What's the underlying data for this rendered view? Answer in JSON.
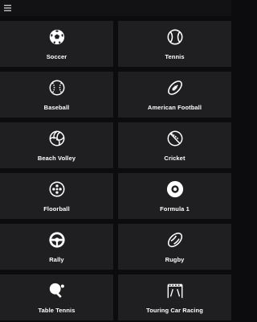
{
  "header": {
    "menu_icon": "hamburger-menu-icon"
  },
  "colors": {
    "background": "#0c0c0e",
    "tile": "#1f1f22",
    "text": "#ffffff"
  },
  "sports": [
    {
      "label": "Soccer",
      "icon": "soccer-ball-icon"
    },
    {
      "label": "Tennis",
      "icon": "tennis-ball-icon"
    },
    {
      "label": "Baseball",
      "icon": "baseball-icon"
    },
    {
      "label": "American Football",
      "icon": "american-football-icon"
    },
    {
      "label": "Beach Volley",
      "icon": "volleyball-icon"
    },
    {
      "label": "Cricket",
      "icon": "cricket-ball-icon"
    },
    {
      "label": "Floorball",
      "icon": "floorball-icon"
    },
    {
      "label": "Formula 1",
      "icon": "racing-tire-icon"
    },
    {
      "label": "Rally",
      "icon": "steering-wheel-icon"
    },
    {
      "label": "Rugby",
      "icon": "rugby-ball-icon"
    },
    {
      "label": "Table Tennis",
      "icon": "table-tennis-paddle-icon"
    },
    {
      "label": "Touring Car Racing",
      "icon": "finish-line-icon"
    }
  ]
}
